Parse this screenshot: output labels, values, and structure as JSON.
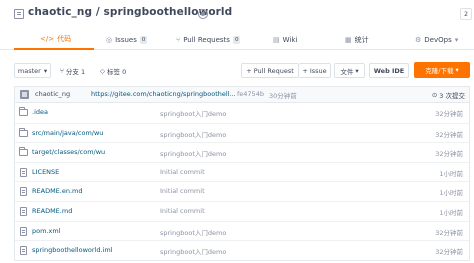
{
  "repo": {
    "title": "chaotic_ng / springboothelloworld",
    "watch_count": "2"
  },
  "tabs": [
    {
      "label": "代码",
      "icon": "code-icon",
      "count": ""
    },
    {
      "label": "Issues",
      "icon": "issue-icon",
      "count": "0"
    },
    {
      "label": "Pull Requests",
      "icon": "pull-request-icon",
      "count": "0"
    },
    {
      "label": "Wiki",
      "icon": "book-icon",
      "count": ""
    },
    {
      "label": "统计",
      "icon": "chart-icon",
      "count": ""
    },
    {
      "label": "DevOps",
      "icon": "devops-icon",
      "count": ""
    }
  ],
  "toolbar": {
    "branch": "master",
    "branch_count_label": "分支 1",
    "tag_count_label": "标签 0",
    "pull_request_label": "+ Pull Request",
    "issue_label": "+ Issue",
    "file_label": "文件",
    "webide_label": "Web IDE",
    "download_label": "克隆/下载"
  },
  "commit": {
    "author": "chaotic_ng",
    "message": "https://gitee.com/chaoticng/springboothell...",
    "hash": "fe4754b",
    "time": "30分钟前",
    "count_label": "3 次提交"
  },
  "files": [
    {
      "name": ".idea",
      "type": "folder",
      "message": "springboot入门demo",
      "time": "32分钟前"
    },
    {
      "name": "src/main/java/com/wu",
      "type": "folder",
      "message": "springboot入门demo",
      "time": "32分钟前"
    },
    {
      "name": "target/classes/com/wu",
      "type": "folder",
      "message": "springboot入门demo",
      "time": "32分钟前"
    },
    {
      "name": "LICENSE",
      "type": "file",
      "message": "Initial commit",
      "time": "1小时前"
    },
    {
      "name": "README.en.md",
      "type": "file",
      "message": "Initial commit",
      "time": "1小时前"
    },
    {
      "name": "README.md",
      "type": "file",
      "message": "Initial commit",
      "time": "1小时前"
    },
    {
      "name": "pom.xml",
      "type": "file",
      "message": "springboot入门demo",
      "time": "32分钟前"
    },
    {
      "name": "springboothelloworld.iml",
      "type": "file",
      "message": "springboot入门demo",
      "time": "32分钟前"
    }
  ],
  "colors": {
    "accent": "#fe7300",
    "link": "#005980",
    "muted": "#8c92a4",
    "border": "#e3e9ed"
  }
}
